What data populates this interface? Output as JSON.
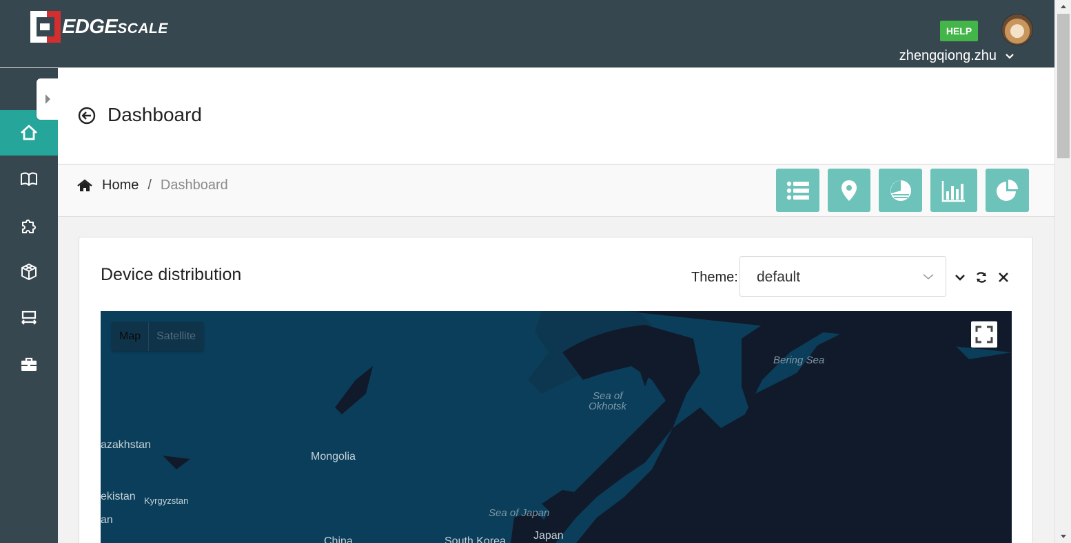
{
  "header": {
    "logo_big": "EDGE",
    "logo_small": "SCALE",
    "help_label": "HELP",
    "username": "zhengqiong.zhu"
  },
  "sidebar": {
    "items": [
      {
        "icon": "home-icon",
        "active": true
      },
      {
        "icon": "book-icon",
        "active": false
      },
      {
        "icon": "puzzle-icon",
        "active": false
      },
      {
        "icon": "cube-icon",
        "active": false
      },
      {
        "icon": "deploy-icon",
        "active": false
      },
      {
        "icon": "toolbox-icon",
        "active": false
      }
    ]
  },
  "page": {
    "title": "Dashboard"
  },
  "breadcrumb": {
    "home": "Home",
    "separator": "/",
    "current": "Dashboard"
  },
  "toolbar": {
    "buttons": [
      "list-icon",
      "map-pin-icon",
      "pie-chart-icon",
      "bar-chart-icon",
      "pie-slice-icon"
    ]
  },
  "card": {
    "title": "Device distribution",
    "theme_label": "Theme:",
    "theme_value": "default"
  },
  "map": {
    "type_map": "Map",
    "type_satellite": "Satellite",
    "labels": {
      "bering_sea": "Bering Sea",
      "sea_of_okhotsk_1": "Sea of",
      "sea_of_okhotsk_2": "Okhotsk",
      "kazakhstan": "azakhstan",
      "mongolia": "Mongolia",
      "uzbekistan": "ekistan",
      "kyrgyzstan": "Kyrgyzstan",
      "an": "an",
      "sea_of_japan": "Sea of Japan",
      "japan": "Japan",
      "china": "China",
      "south_korea": "South Korea"
    }
  },
  "colors": {
    "header_bg": "#37474f",
    "accent": "#26a69a",
    "tool_button": "#6dc2b9",
    "help_green": "#43b549",
    "map_water": "#0b3e5a",
    "map_land": "#111a2a"
  }
}
